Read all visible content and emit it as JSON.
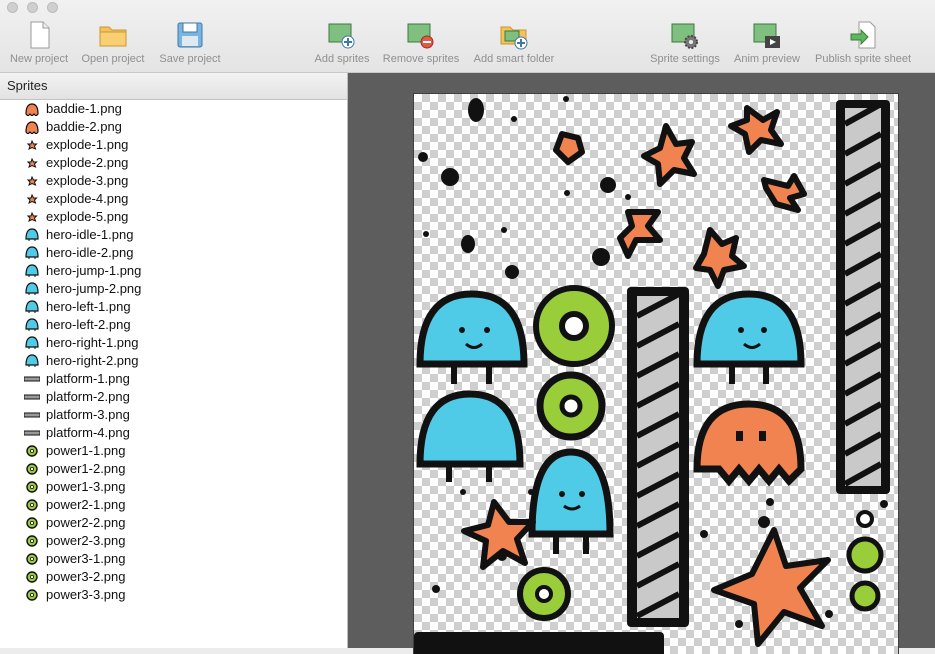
{
  "toolbar": {
    "new_project": "New project",
    "open_project": "Open project",
    "save_project": "Save project",
    "add_sprites": "Add sprites",
    "remove_sprites": "Remove sprites",
    "add_smart_folder": "Add smart folder",
    "sprite_settings": "Sprite settings",
    "anim_preview": "Anim preview",
    "publish_sprite_sheet": "Publish sprite sheet"
  },
  "sidebar": {
    "title": "Sprites",
    "items": [
      {
        "label": "baddie-1.png",
        "icon": "baddie-icon"
      },
      {
        "label": "baddie-2.png",
        "icon": "baddie-icon"
      },
      {
        "label": "explode-1.png",
        "icon": "explode-icon"
      },
      {
        "label": "explode-2.png",
        "icon": "explode-icon"
      },
      {
        "label": "explode-3.png",
        "icon": "explode-icon"
      },
      {
        "label": "explode-4.png",
        "icon": "explode-icon"
      },
      {
        "label": "explode-5.png",
        "icon": "explode-icon"
      },
      {
        "label": "hero-idle-1.png",
        "icon": "hero-icon"
      },
      {
        "label": "hero-idle-2.png",
        "icon": "hero-icon"
      },
      {
        "label": "hero-jump-1.png",
        "icon": "hero-icon"
      },
      {
        "label": "hero-jump-2.png",
        "icon": "hero-icon"
      },
      {
        "label": "hero-left-1.png",
        "icon": "hero-icon"
      },
      {
        "label": "hero-left-2.png",
        "icon": "hero-icon"
      },
      {
        "label": "hero-right-1.png",
        "icon": "hero-icon"
      },
      {
        "label": "hero-right-2.png",
        "icon": "hero-icon"
      },
      {
        "label": "platform-1.png",
        "icon": "platform-icon"
      },
      {
        "label": "platform-2.png",
        "icon": "platform-icon"
      },
      {
        "label": "platform-3.png",
        "icon": "platform-icon"
      },
      {
        "label": "platform-4.png",
        "icon": "platform-icon"
      },
      {
        "label": "power1-1.png",
        "icon": "power-icon"
      },
      {
        "label": "power1-2.png",
        "icon": "power-icon"
      },
      {
        "label": "power1-3.png",
        "icon": "power-icon"
      },
      {
        "label": "power2-1.png",
        "icon": "power-icon"
      },
      {
        "label": "power2-2.png",
        "icon": "power-icon"
      },
      {
        "label": "power2-3.png",
        "icon": "power-icon"
      },
      {
        "label": "power3-1.png",
        "icon": "power-icon"
      },
      {
        "label": "power3-2.png",
        "icon": "power-icon"
      },
      {
        "label": "power3-3.png",
        "icon": "power-icon"
      }
    ]
  },
  "colors": {
    "hero": "#4fcbe8",
    "baddie": "#f0834f",
    "power": "#9acd3a",
    "outline": "#111111"
  }
}
